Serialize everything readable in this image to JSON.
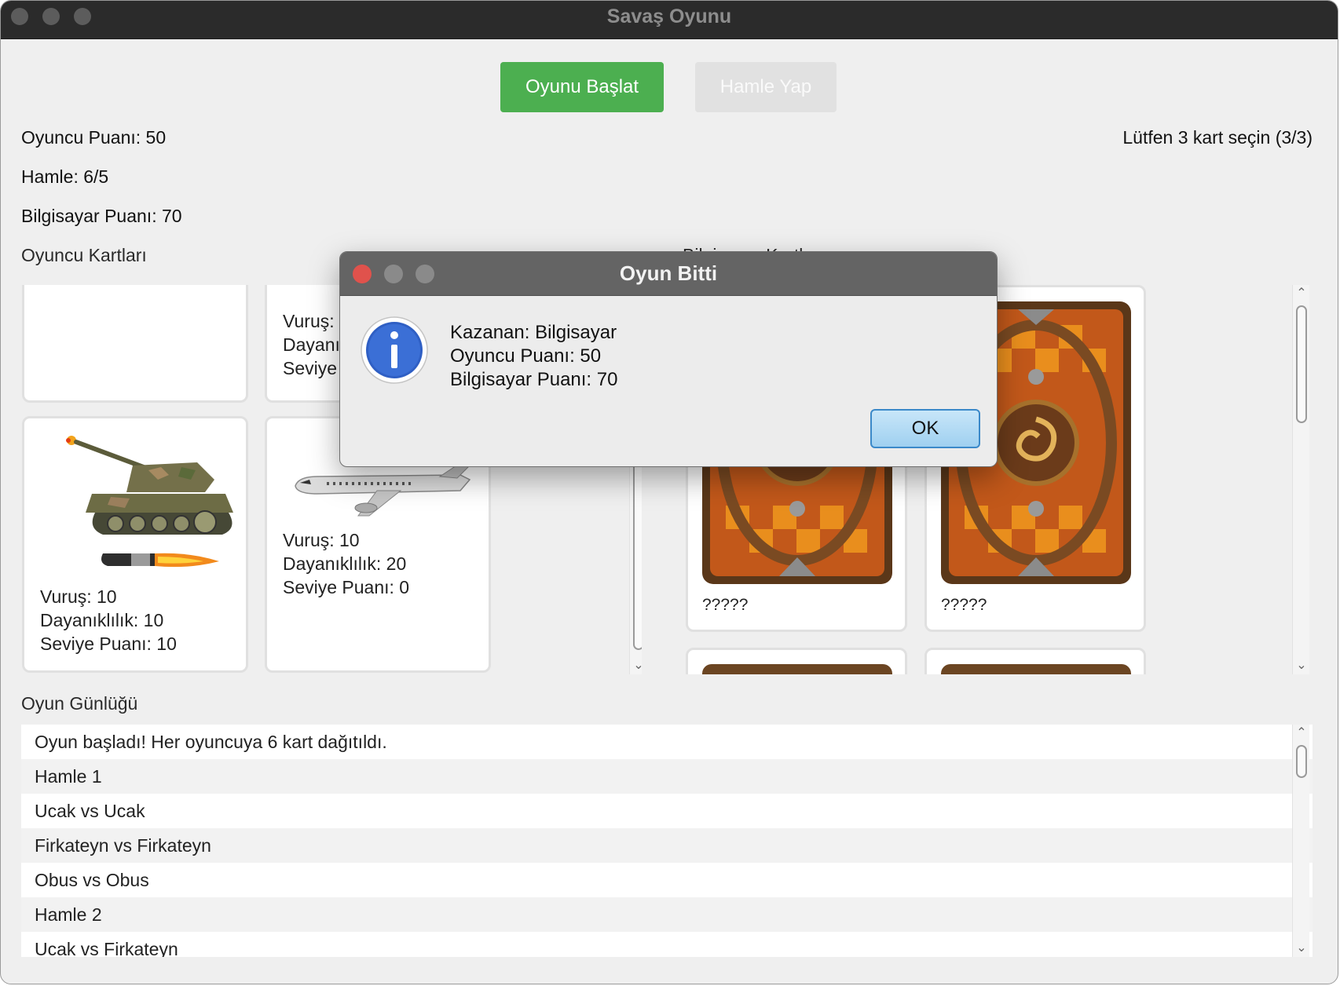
{
  "window": {
    "title": "Savaş Oyunu"
  },
  "toolbar": {
    "start_label": "Oyunu Başlat",
    "move_label": "Hamle Yap"
  },
  "status": {
    "player_score": "Oyuncu Puanı: 50",
    "move_count": "Hamle: 6/5",
    "computer_score": "Bilgisayar Puanı: 70",
    "selection_hint": "Lütfen 3 kart seçin (3/3)"
  },
  "player_cards": {
    "section_label": "Oyuncu Kartları",
    "cards": [
      {
        "unit": "empty",
        "lines": []
      },
      {
        "unit": "partial",
        "lines": [
          "Vuruş:",
          "Dayanı",
          "Seviye"
        ]
      },
      {
        "unit": "tank-icon",
        "lines": [
          "Vuruş: 10",
          "Dayanıklılık: 10",
          "Seviye Puanı: 10"
        ]
      },
      {
        "unit": "plane-icon",
        "lines": [
          "Vuruş: 10",
          "Dayanıklılık: 20",
          "Seviye Puanı: 0"
        ]
      }
    ]
  },
  "computer_cards": {
    "section_label": "Bilgisayar Kartları",
    "hidden_label": "?????"
  },
  "game_log": {
    "section_label": "Oyun Günlüğü",
    "entries": [
      "Oyun başladı! Her oyuncuya 6 kart dağıtıldı.",
      "Hamle 1",
      "Ucak vs Ucak",
      "Firkateyn vs Firkateyn",
      "Obus vs Obus",
      "Hamle 2",
      "Ucak vs Firkateyn"
    ]
  },
  "dialog": {
    "title": "Oyun Bitti",
    "icon": "info-icon",
    "lines": [
      "Kazanan: Bilgisayar",
      "Oyuncu Puanı: 50",
      "Bilgisayar Puanı: 70"
    ],
    "ok_label": "OK"
  },
  "colors": {
    "start_button": "#4caf50",
    "ok_button_border": "#3b89c9",
    "close_dot": "#e0524c"
  }
}
